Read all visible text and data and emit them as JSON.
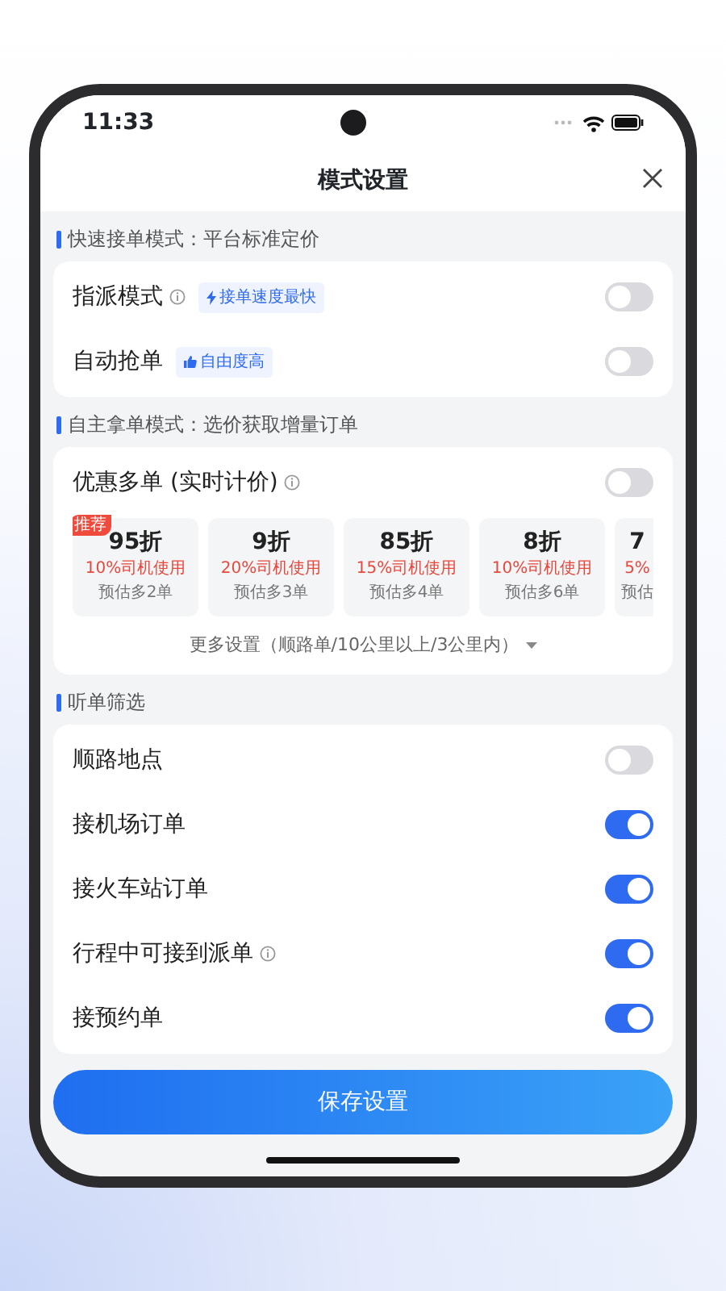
{
  "status_bar": {
    "time": "11:33"
  },
  "header": {
    "title": "模式设置"
  },
  "sections": [
    {
      "title": "快速接单模式：平台标准定价",
      "kind": "toggles",
      "rows": [
        {
          "label": "指派模式",
          "info": true,
          "tag": {
            "text": "接单速度最快",
            "kind": "speed"
          },
          "on": false
        },
        {
          "label": "自动抢单",
          "info": false,
          "tag": {
            "text": "自由度高",
            "kind": "freedom"
          },
          "on": false
        }
      ]
    },
    {
      "title": "自主拿单模式：选价获取增量订单",
      "kind": "discount",
      "rows": [
        {
          "label": "优惠多单 (实时计价)",
          "info": true,
          "on": false
        }
      ],
      "cards": [
        {
          "discount": "95折",
          "usage": "10%司机使用",
          "estimate": "预估多2单",
          "ribbon": "推荐"
        },
        {
          "discount": "9折",
          "usage": "20%司机使用",
          "estimate": "预估多3单"
        },
        {
          "discount": "85折",
          "usage": "15%司机使用",
          "estimate": "预估多4单"
        },
        {
          "discount": "8折",
          "usage": "10%司机使用",
          "estimate": "预估多6单"
        },
        {
          "discount": "7",
          "usage": "5%",
          "estimate": "预估"
        }
      ],
      "more": "更多设置（顺路单/10公里以上/3公里内）"
    },
    {
      "title": "听单筛选",
      "kind": "toggles",
      "rows": [
        {
          "label": "顺路地点",
          "info": false,
          "on": false
        },
        {
          "label": "接机场订单",
          "info": false,
          "on": true
        },
        {
          "label": "接火车站订单",
          "info": false,
          "on": true
        },
        {
          "label": "行程中可接到派单",
          "info": true,
          "on": true
        },
        {
          "label": "接预约单",
          "info": false,
          "on": true
        }
      ]
    }
  ],
  "save_button": "保存设置"
}
